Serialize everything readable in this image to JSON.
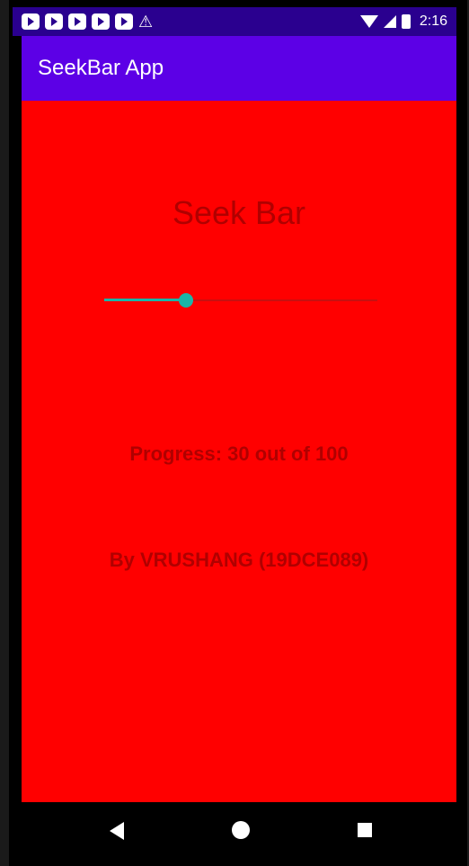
{
  "status_bar": {
    "time": "2:16",
    "notification_icons": [
      "youtube-icon",
      "youtube-icon",
      "youtube-icon",
      "youtube-icon",
      "youtube-icon",
      "warning-icon"
    ],
    "system_icons": [
      "wifi-icon",
      "signal-icon",
      "battery-icon"
    ]
  },
  "app_bar": {
    "title": "SeekBar App"
  },
  "main": {
    "title": "Seek Bar",
    "seekbar": {
      "value": 30,
      "max": 100
    },
    "progress_text": "Progress: 30 out of 100",
    "author": "By VRUSHANG (19DCE089)"
  },
  "colors": {
    "background": "#ff0000",
    "app_bar": "#5c00e6",
    "status_bar": "#2a008f",
    "text": "#b00000",
    "accent": "#1cb5a8"
  },
  "nav_bar": {
    "buttons": [
      "back-icon",
      "home-icon",
      "recents-icon"
    ]
  }
}
